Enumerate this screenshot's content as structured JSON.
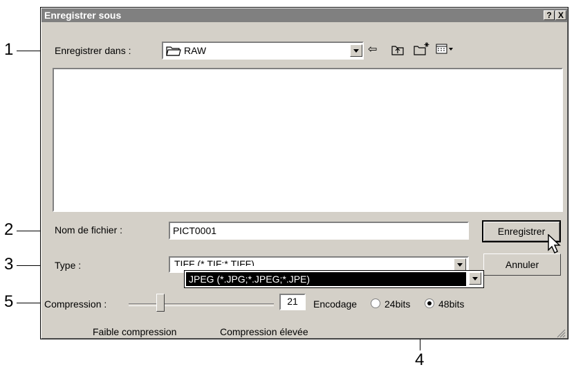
{
  "callouts": [
    "1",
    "2",
    "3",
    "5",
    "4"
  ],
  "dialog": {
    "title": "Enregistrer sous",
    "help_btn": "?",
    "close_btn": "X",
    "save_in_label": "Enregistrer dans :",
    "save_in_value": "RAW",
    "filename_label": "Nom de fichier :",
    "filename_value": "PICT0001",
    "type_label": "Type :",
    "type_value": "TIFF (*.TIF;*.TIFF)",
    "type_dropdown_option": "JPEG (*.JPG;*.JPEG;*.JPE)",
    "save_button": "Enregistrer",
    "cancel_button": "Annuler",
    "compression_label": "Compression :",
    "compression_value": "21",
    "encoding_label": "Encodage",
    "option_24": "24bits",
    "option_48": "48bits",
    "low_compression": "Faible compression",
    "high_compression": "Compression élevée"
  },
  "icons": [
    "folder-icon",
    "back-arrow-icon",
    "up-folder-icon",
    "new-folder-icon",
    "view-menu-icon",
    "mouse-cursor-icon"
  ]
}
